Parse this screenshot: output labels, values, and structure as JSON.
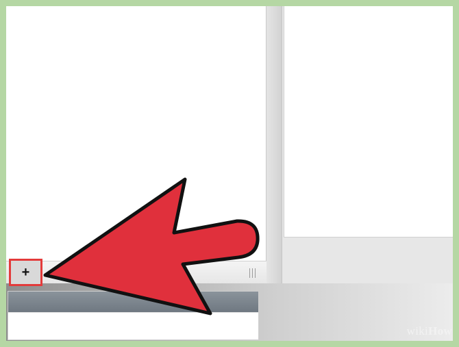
{
  "toolbar": {
    "add_label": "+"
  },
  "annotation": {
    "arrow_color": "#e0303c",
    "highlight_color": "#e33b3b",
    "frame_color": "#b5d7a4"
  },
  "watermark": {
    "prefix": "wiki",
    "brand": "How"
  }
}
